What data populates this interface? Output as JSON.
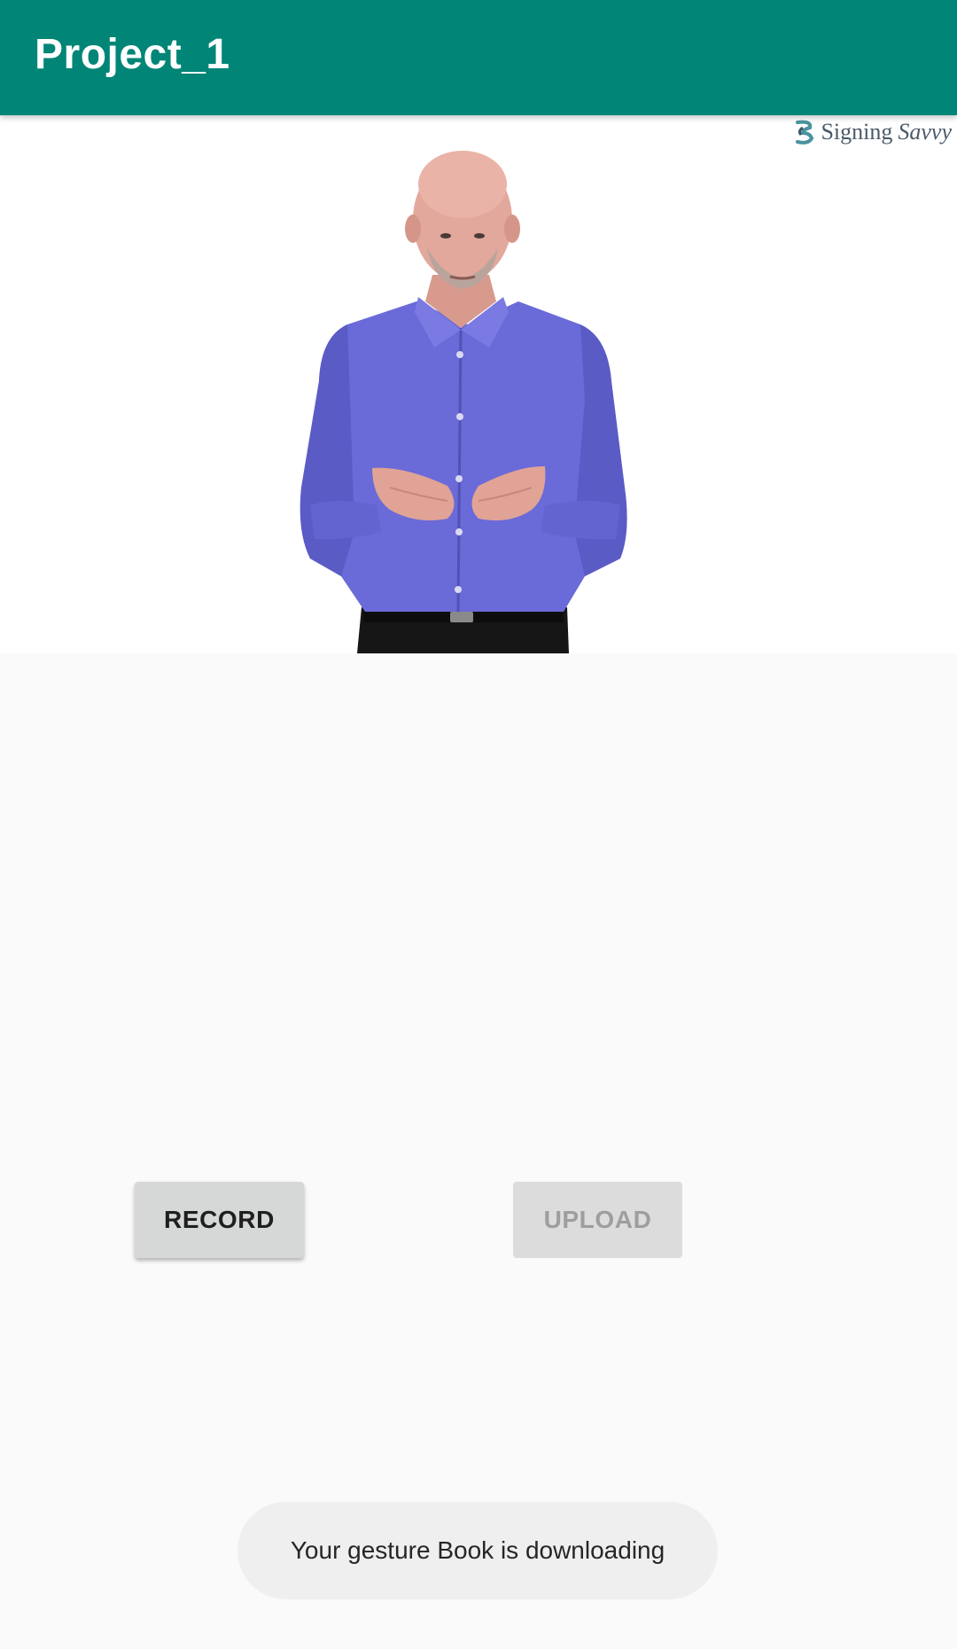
{
  "app_bar": {
    "title": "Project_1",
    "color": "#008577"
  },
  "video": {
    "watermark_text_primary": "Signing",
    "watermark_text_secondary": "Savvy",
    "shirt_color": "#6a6ad8"
  },
  "buttons": {
    "record_label": "RECORD",
    "upload_label": "UPLOAD",
    "upload_enabled": false
  },
  "toast": {
    "message": "Your gesture Book is downloading"
  }
}
